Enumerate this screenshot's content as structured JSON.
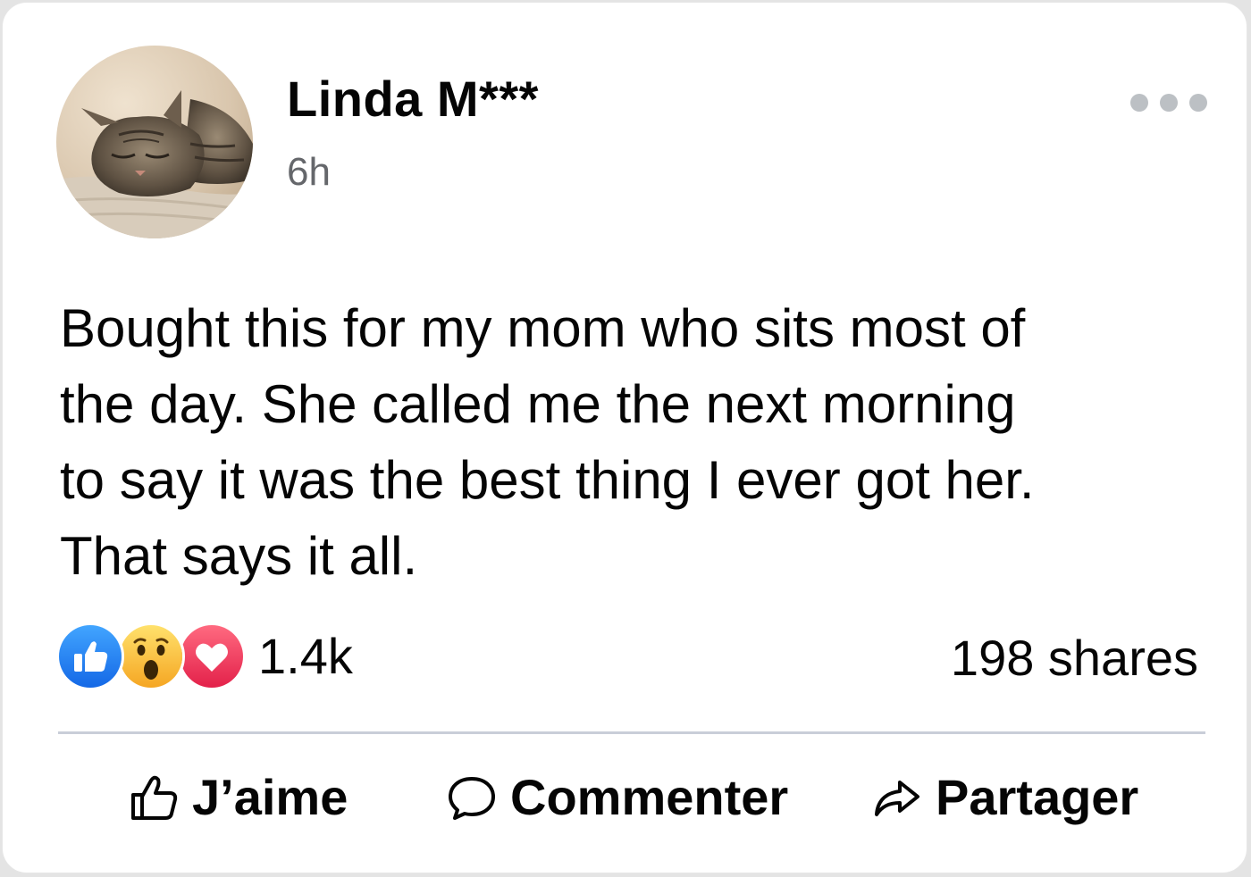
{
  "post": {
    "author": "Linda M***",
    "timestamp": "6h",
    "avatar_icon": "cat-photo-avatar",
    "more_icon": "more-options-icon",
    "text_lines": [
      "Bought this for my mom who sits most of",
      "the day. She called me the next morning",
      "to say it was the best thing I ever got her.",
      "That says it all."
    ]
  },
  "stats": {
    "reactions": [
      {
        "icon": "like-reaction-icon",
        "color": "#1877f2"
      },
      {
        "icon": "wow-reaction-icon",
        "color": "#f7b125"
      },
      {
        "icon": "love-reaction-icon",
        "color": "#f33e58"
      }
    ],
    "reaction_count": "1.4k",
    "shares": "198 shares"
  },
  "actions": {
    "like_label": "J’aime",
    "comment_label": "Commenter",
    "share_label": "Partager",
    "like_icon": "thumbs-up-outline-icon",
    "comment_icon": "comment-bubble-icon",
    "share_icon": "share-arrow-icon"
  },
  "colors": {
    "text_primary": "#050505",
    "text_secondary": "#65676b",
    "divider": "#c9ced8"
  }
}
